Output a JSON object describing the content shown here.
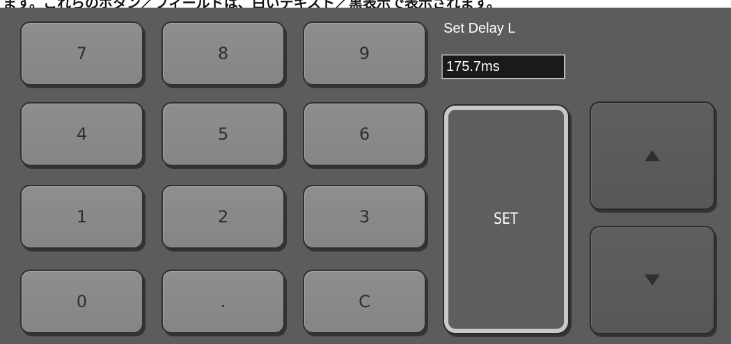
{
  "caption": {
    "text": "ます。これらのボタン／フィールドは、白いテキスト／黒表示で表示されます。"
  },
  "keypad": {
    "keys": [
      {
        "id": "7",
        "label": "7"
      },
      {
        "id": "8",
        "label": "8"
      },
      {
        "id": "9",
        "label": "9"
      },
      {
        "id": "4",
        "label": "4"
      },
      {
        "id": "5",
        "label": "5"
      },
      {
        "id": "6",
        "label": "6"
      },
      {
        "id": "1",
        "label": "1"
      },
      {
        "id": "2",
        "label": "2"
      },
      {
        "id": "3",
        "label": "3"
      },
      {
        "id": "0",
        "label": "0"
      },
      {
        "id": "dot",
        "label": "."
      },
      {
        "id": "clear",
        "label": "C"
      }
    ]
  },
  "delay": {
    "label": "Set Delay L",
    "value": "175.7ms"
  },
  "set_button": {
    "label": "SET"
  },
  "arrows": {
    "up_icon": "triangle-up",
    "down_icon": "triangle-down"
  },
  "colors": {
    "panel_background": "#5c5c5c",
    "key_face": "#8a8a8a",
    "set_key_border": "#c9c9c9",
    "field_background": "#1a1a1a"
  }
}
